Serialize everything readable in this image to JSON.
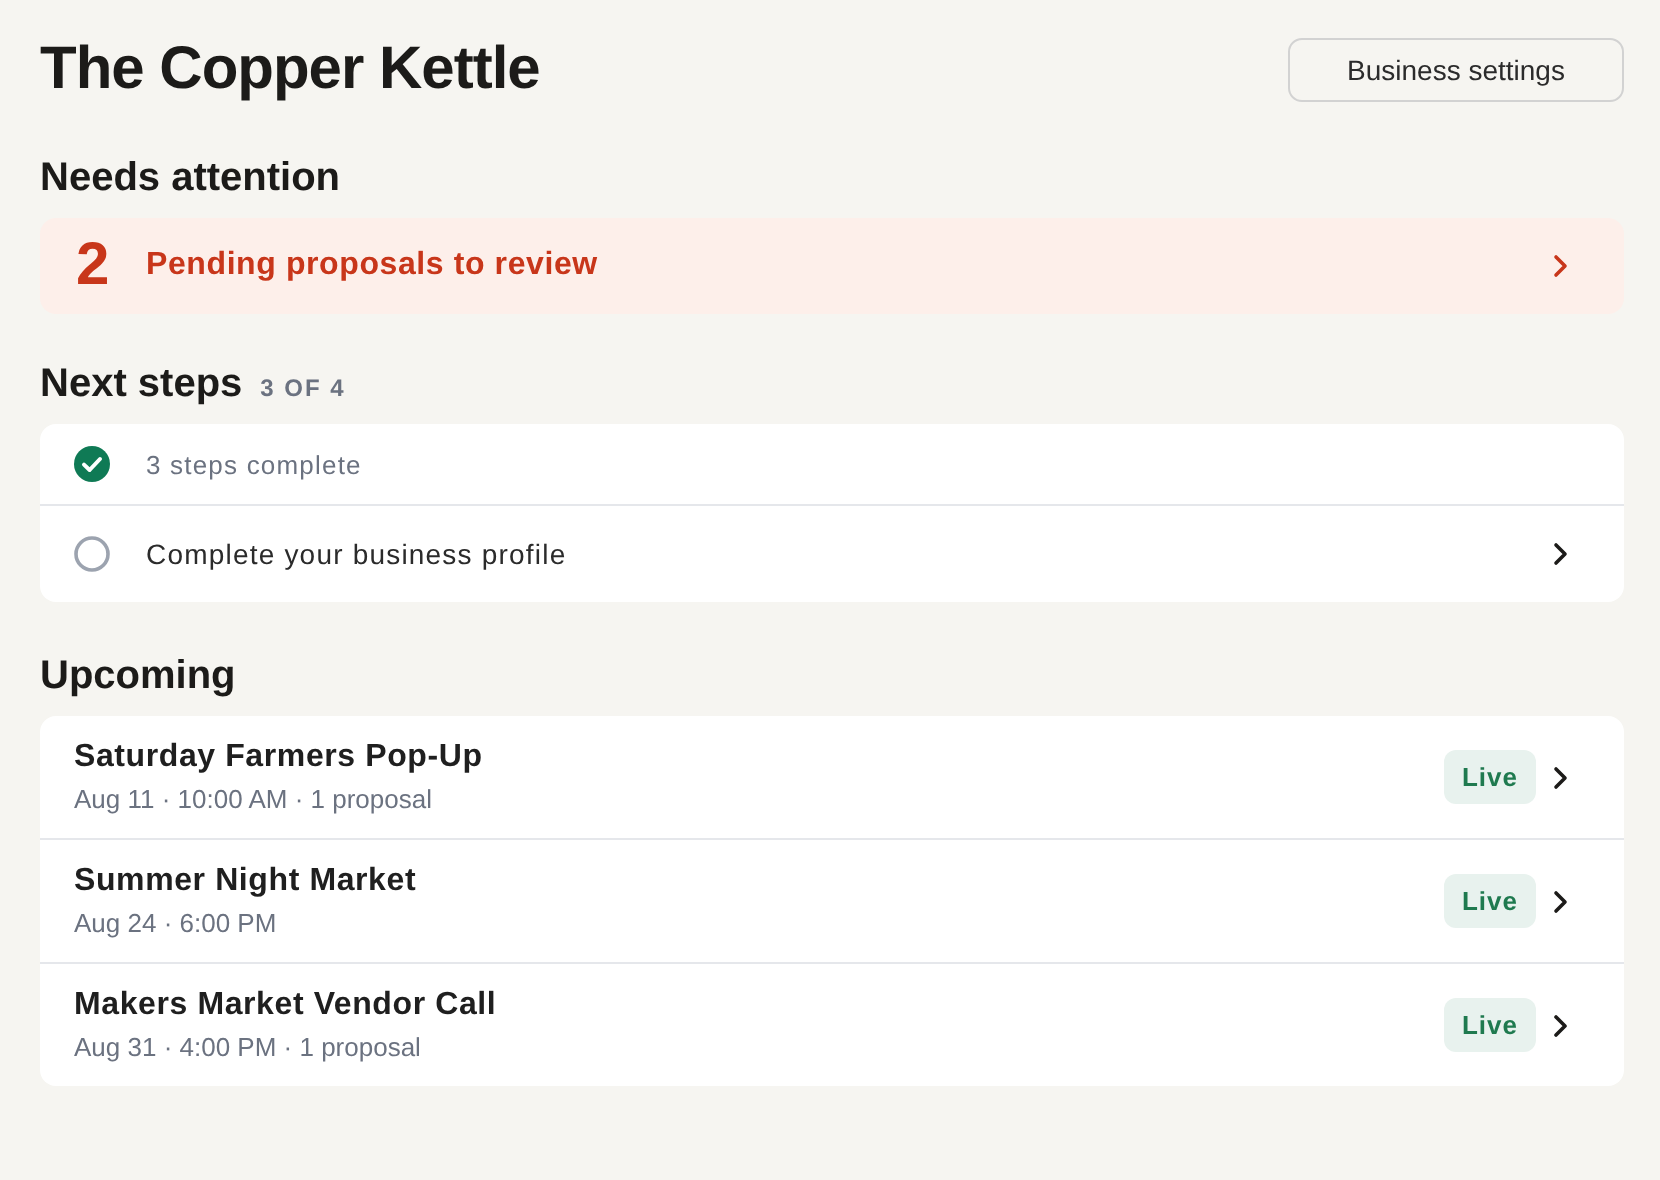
{
  "header": {
    "title": "The Copper Kettle",
    "settings_button": "Business settings"
  },
  "attention": {
    "heading": "Needs attention",
    "count": "2",
    "label": "Pending proposals to review"
  },
  "next_steps": {
    "heading": "Next steps",
    "progress": "3 OF 4",
    "steps": [
      {
        "label": "3 steps complete",
        "checked": true
      },
      {
        "label": "Complete your business profile",
        "checked": false
      }
    ]
  },
  "upcoming": {
    "heading": "Upcoming",
    "events": [
      {
        "name": "Saturday Farmers Pop-Up",
        "details": "Aug 11 · 10:00 AM · 1 proposal",
        "status": "Live"
      },
      {
        "name": "Summer Night Market",
        "details": "Aug 24 · 6:00 PM",
        "status": "Live"
      },
      {
        "name": "Makers Market Vendor Call",
        "details": "Aug 31 · 4:00 PM · 1 proposal",
        "status": "Live"
      }
    ]
  }
}
